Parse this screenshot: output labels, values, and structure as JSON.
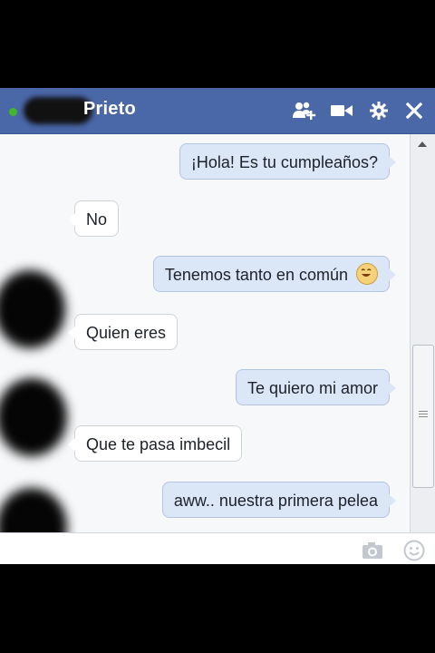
{
  "header": {
    "contact_name": "Prieto",
    "status": "online",
    "icons": [
      "add-friend-icon",
      "video-call-icon",
      "gear-icon",
      "close-icon"
    ]
  },
  "messages": [
    {
      "direction": "out",
      "text": "¡Hola! Es tu cumpleaños?"
    },
    {
      "direction": "in",
      "text": "No"
    },
    {
      "direction": "out",
      "text": "Tenemos tanto en común",
      "emoji": "smiley-icon"
    },
    {
      "direction": "in",
      "text": "Quien eres"
    },
    {
      "direction": "out",
      "text": "Te quiero mi amor"
    },
    {
      "direction": "in",
      "text": "Que te pasa imbecil"
    },
    {
      "direction": "out",
      "text": "aww.. nuestra primera pelea"
    }
  ],
  "composer": {
    "value": "",
    "icons": [
      "camera-icon",
      "emoticon-icon"
    ]
  },
  "colors": {
    "titlebar": "#4a67a8",
    "outgoing_bubble": "#dbe6f7",
    "incoming_bubble": "#ffffff",
    "online": "#42b72a"
  }
}
